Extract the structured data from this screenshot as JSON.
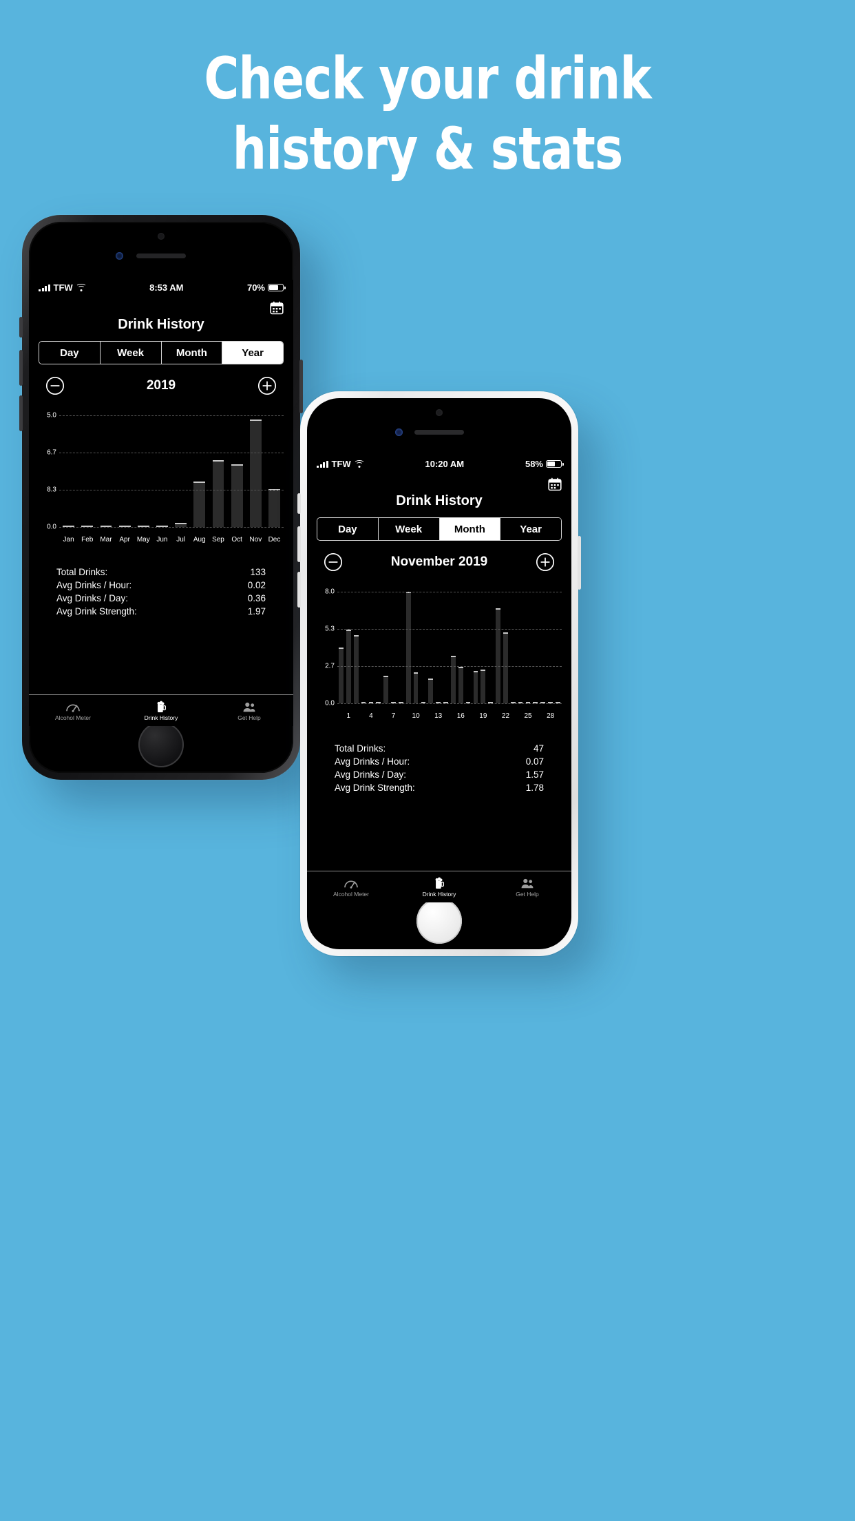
{
  "promo": {
    "headline_line1": "Check your drink",
    "headline_line2": "history & stats",
    "background_color": "#58b4dd",
    "headline_color": "#ffffff"
  },
  "phone_dark": {
    "status_bar": {
      "carrier": "TFW",
      "wifi_icon": "wifi-icon",
      "time": "8:53 AM",
      "battery_percent": "70%",
      "battery_icon": "battery-icon",
      "signal_icon": "signal-bars-icon"
    },
    "nav": {
      "title": "Drink History",
      "calendar_icon": "calendar-icon"
    },
    "segments": [
      {
        "label": "Day",
        "selected": false
      },
      {
        "label": "Week",
        "selected": false
      },
      {
        "label": "Month",
        "selected": false
      },
      {
        "label": "Year",
        "selected": true
      }
    ],
    "period": {
      "label": "2019",
      "decrement_icon": "minus-circle-icon",
      "increment_icon": "plus-circle-icon"
    },
    "chart_data": {
      "type": "bar",
      "title": "2019",
      "xlabel": "",
      "ylabel": "",
      "grid": true,
      "legend": "none",
      "ytick_labels": [
        "5.0",
        "6.7",
        "8.3",
        "0.0"
      ],
      "ylim": [
        0,
        10
      ],
      "categories": [
        "Jan",
        "Feb",
        "Mar",
        "Apr",
        "May",
        "Jun",
        "Jul",
        "Aug",
        "Sep",
        "Oct",
        "Nov",
        "Dec"
      ],
      "values": [
        0.1,
        0.15,
        0.15,
        0.15,
        0.15,
        0.15,
        0.4,
        4.1,
        6.0,
        5.6,
        9.6,
        3.4
      ],
      "bar_color": "#2b2b2b",
      "bar_cap_color": "#c8c8c8"
    },
    "stats": [
      {
        "label": "Total Drinks:",
        "value": "133"
      },
      {
        "label": "Avg Drinks / Hour:",
        "value": "0.02"
      },
      {
        "label": "Avg Drinks / Day:",
        "value": "0.36"
      },
      {
        "label": "Avg Drink Strength:",
        "value": "1.97"
      }
    ],
    "tabs": [
      {
        "label": "Alcohol Meter",
        "icon": "speedometer-icon",
        "active": false
      },
      {
        "label": "Drink History",
        "icon": "beer-mug-icon",
        "active": true
      },
      {
        "label": "Get Help",
        "icon": "people-icon",
        "active": false
      }
    ]
  },
  "phone_light": {
    "status_bar": {
      "carrier": "TFW",
      "wifi_icon": "wifi-icon",
      "time": "10:20 AM",
      "battery_percent": "58%",
      "battery_icon": "battery-icon",
      "signal_icon": "signal-bars-icon"
    },
    "nav": {
      "title": "Drink History",
      "calendar_icon": "calendar-icon"
    },
    "segments": [
      {
        "label": "Day",
        "selected": false
      },
      {
        "label": "Week",
        "selected": false
      },
      {
        "label": "Month",
        "selected": true
      },
      {
        "label": "Year",
        "selected": false
      }
    ],
    "period": {
      "label": "November 2019",
      "decrement_icon": "minus-circle-icon",
      "increment_icon": "plus-circle-icon"
    },
    "chart_data": {
      "type": "bar",
      "title": "November 2019",
      "xlabel": "",
      "ylabel": "",
      "grid": true,
      "legend": "none",
      "ytick_labels": [
        "8.0",
        "5.3",
        "2.7",
        "0.0"
      ],
      "ylim": [
        0,
        8
      ],
      "categories": [
        "1",
        "2",
        "3",
        "4",
        "5",
        "6",
        "7",
        "8",
        "9",
        "10",
        "11",
        "12",
        "13",
        "14",
        "15",
        "16",
        "17",
        "18",
        "19",
        "20",
        "21",
        "22",
        "23",
        "24",
        "25",
        "26",
        "27",
        "28",
        "29",
        "30"
      ],
      "xtick_labels": [
        "1",
        "4",
        "7",
        "10",
        "13",
        "16",
        "19",
        "22",
        "25",
        "28"
      ],
      "values": [
        4.0,
        5.3,
        4.9,
        0,
        0,
        0,
        2.0,
        0,
        0,
        8.0,
        2.2,
        0,
        1.8,
        0,
        0,
        3.4,
        2.6,
        0,
        2.3,
        2.4,
        0,
        6.8,
        5.1,
        0,
        0,
        0,
        0,
        0,
        0,
        0
      ],
      "bar_color": "#2b2b2b",
      "bar_cap_color": "#c8c8c8"
    },
    "stats": [
      {
        "label": "Total Drinks:",
        "value": "47"
      },
      {
        "label": "Avg Drinks / Hour:",
        "value": "0.07"
      },
      {
        "label": "Avg Drinks / Day:",
        "value": "1.57"
      },
      {
        "label": "Avg Drink Strength:",
        "value": "1.78"
      }
    ],
    "tabs": [
      {
        "label": "Alcohol Meter",
        "icon": "speedometer-icon",
        "active": false
      },
      {
        "label": "Drink History",
        "icon": "beer-mug-icon",
        "active": true
      },
      {
        "label": "Get Help",
        "icon": "people-icon",
        "active": false
      }
    ]
  }
}
